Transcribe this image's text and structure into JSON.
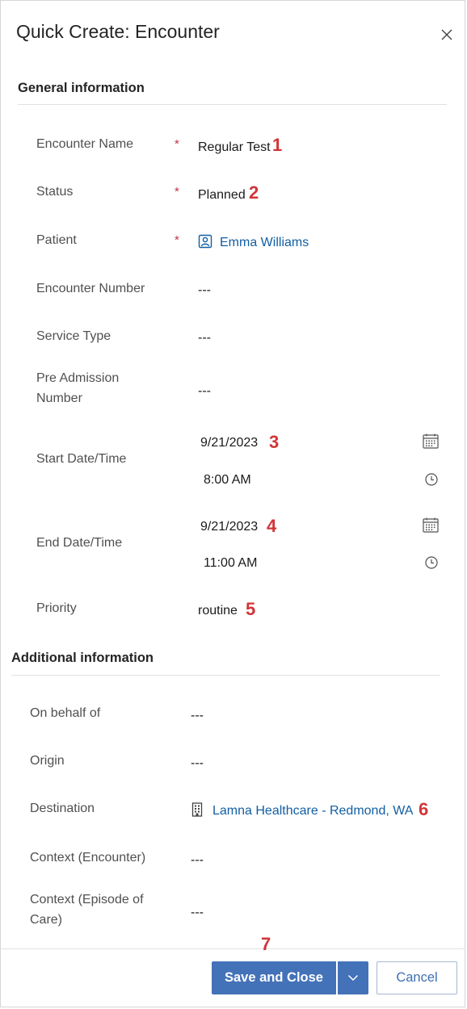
{
  "dialog": {
    "title": "Quick Create: Encounter"
  },
  "general": {
    "heading": "General information",
    "encounter_name": {
      "label": "Encounter Name",
      "required": "*",
      "value": "Regular Test",
      "badge": "1"
    },
    "status": {
      "label": "Status",
      "required": "*",
      "value": "Planned",
      "badge": "2"
    },
    "patient": {
      "label": "Patient",
      "required": "*",
      "value": "Emma Williams",
      "icon": "contact-icon"
    },
    "encounter_number": {
      "label": "Encounter Number",
      "value": "---"
    },
    "service_type": {
      "label": "Service Type",
      "value": "---"
    },
    "pre_admission": {
      "label_line1": "Pre Admission",
      "label_line2": "Number",
      "value": "---"
    },
    "start": {
      "label": "Start Date/Time",
      "date": "9/21/2023",
      "time": "8:00 AM",
      "badge": "3"
    },
    "end": {
      "label": "End Date/Time",
      "date": "9/21/2023",
      "time": "11:00 AM",
      "badge": "4"
    },
    "priority": {
      "label": "Priority",
      "value": "routine",
      "badge": "5"
    }
  },
  "additional": {
    "heading": "Additional information",
    "on_behalf_of": {
      "label": "On behalf of",
      "value": "---"
    },
    "origin": {
      "label": "Origin",
      "value": "---"
    },
    "destination": {
      "label": "Destination",
      "value": "Lamna Healthcare - Redmond, WA",
      "badge": "6",
      "icon": "building-icon"
    },
    "context_encounter": {
      "label": "Context (Encounter)",
      "value": "---"
    },
    "context_episode": {
      "label_line1": "Context (Episode of",
      "label_line2": "Care)",
      "value": "---"
    }
  },
  "footer": {
    "badge": "7",
    "save_label": "Save and Close",
    "cancel_label": "Cancel"
  },
  "colors": {
    "primary": "#4472b8",
    "link": "#115ea3",
    "required": "#c4314b",
    "badge": "#d13438"
  }
}
